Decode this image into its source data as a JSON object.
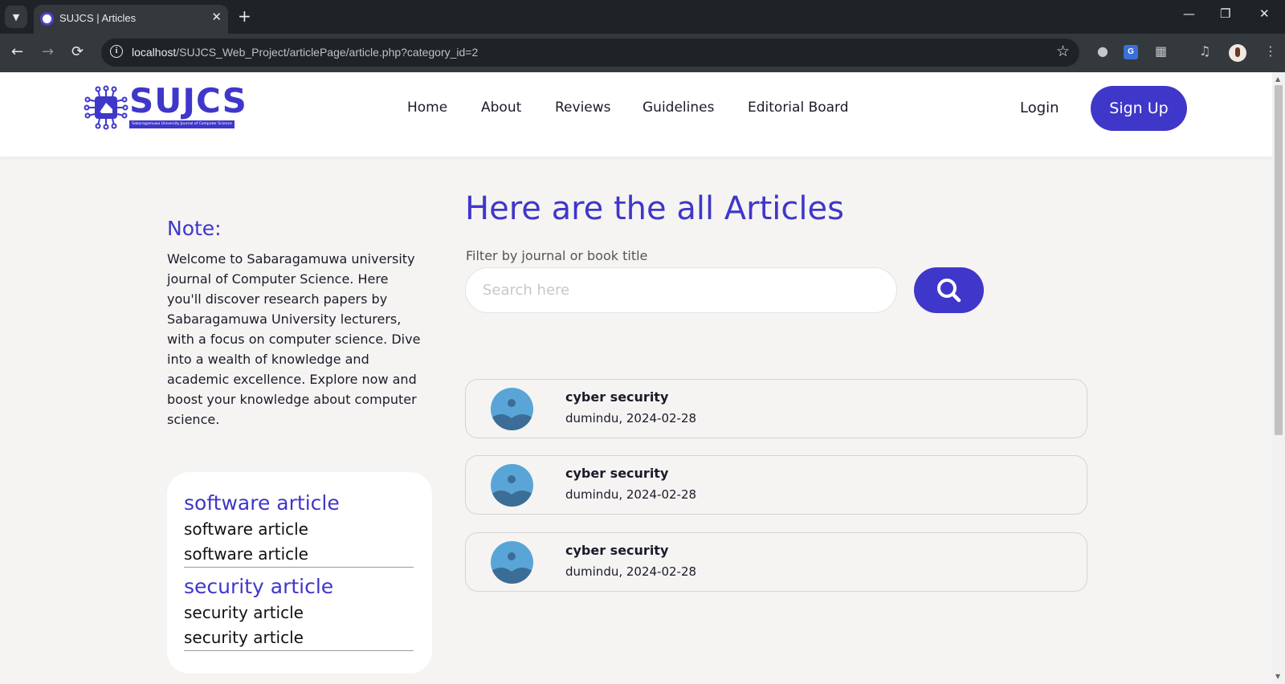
{
  "browser": {
    "tab_title": "SUJCS | Articles",
    "url_host": "localhost",
    "url_path": "/SUJCS_Web_Project/articlePage/article.php?category_id=2"
  },
  "site": {
    "logo_text": "SUJCS",
    "logo_subtitle": "Sabaragamuwa University Journal of Computer Science",
    "nav": [
      "Home",
      "About",
      "Reviews",
      "Guidelines",
      "Editorial Board"
    ],
    "login_label": "Login",
    "signup_label": "Sign Up",
    "brand_color": "#3f37c9"
  },
  "sidebar": {
    "note_title": "Note:",
    "note_body": "Welcome to Sabaragamuwa university journal of Computer Science. Here you'll discover research papers by Sabaragamuwa University lecturers, with a focus on computer science. Dive into a wealth of knowledge and academic excellence. Explore now and boost your knowledge about computer science.",
    "categories": [
      {
        "heading": "software article",
        "items": [
          "software article",
          "software article"
        ]
      },
      {
        "heading": "security article",
        "items": [
          "security article",
          "security article"
        ]
      }
    ]
  },
  "main": {
    "title": "Here are the all Articles",
    "filter_label": "Filter by journal or book title",
    "search_placeholder": "Search here",
    "search_icon": "search-icon",
    "articles": [
      {
        "title": "cyber security",
        "meta": "dumindu, 2024-02-28",
        "icon": "image-placeholder-icon"
      },
      {
        "title": "cyber security",
        "meta": "dumindu, 2024-02-28",
        "icon": "image-placeholder-icon"
      },
      {
        "title": "cyber security",
        "meta": "dumindu, 2024-02-28",
        "icon": "image-placeholder-icon"
      }
    ]
  }
}
